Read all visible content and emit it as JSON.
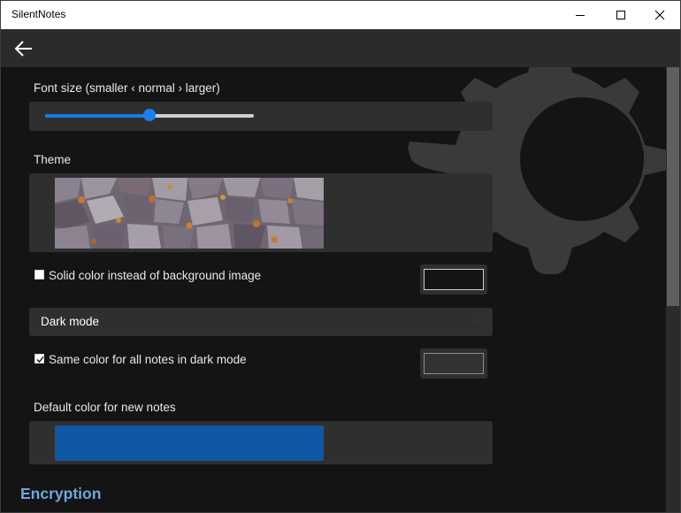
{
  "window": {
    "title": "SilentNotes"
  },
  "settings": {
    "font_size": {
      "label": "Font size (smaller ‹ normal › larger)",
      "value_percent": 50
    },
    "theme": {
      "label": "Theme"
    },
    "solid_color": {
      "label": "Solid color instead of background image",
      "checked": false,
      "color": "#141414"
    },
    "dark_mode": {
      "selected": "Dark mode"
    },
    "same_color": {
      "label": "Same color for all notes in dark mode",
      "checked": true,
      "color": "#323232"
    },
    "default_color": {
      "label": "Default color for new notes",
      "color": "#0f58a3"
    },
    "encryption": {
      "heading": "Encryption"
    }
  },
  "colors": {
    "accent": "#1978e6",
    "heading": "#6fa6df",
    "background": "#141414",
    "panel": "#2f2f2f",
    "appbar": "#2b2b2b"
  }
}
